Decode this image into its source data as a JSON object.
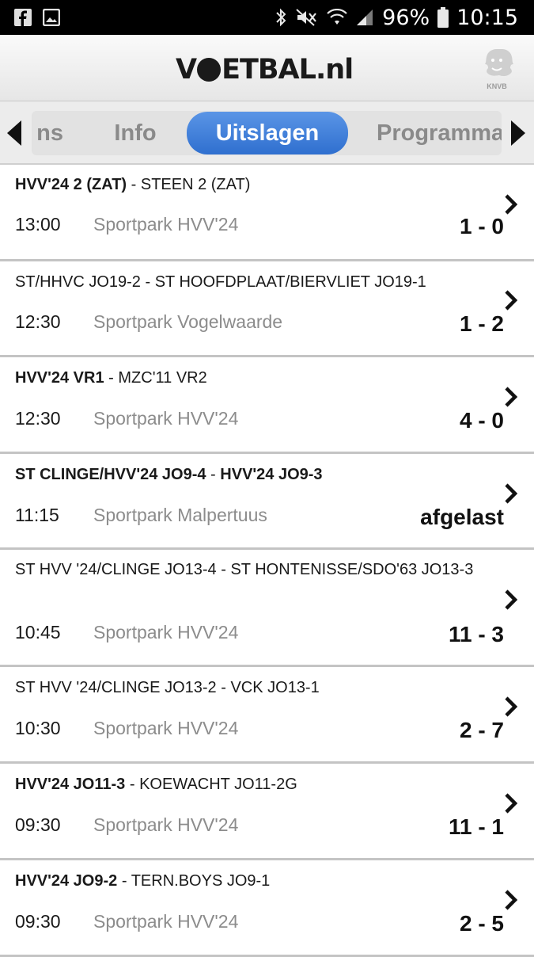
{
  "status_bar": {
    "battery_percent": "96%",
    "time": "10:15",
    "icons": [
      "facebook-icon",
      "gallery-icon",
      "bluetooth-icon",
      "mute-icon",
      "wifi-icon",
      "signal-icon",
      "battery-icon"
    ]
  },
  "header": {
    "logo_text_left": "V",
    "logo_text_right": "ETBAL.nl",
    "knvb_label": "KNVB"
  },
  "tabs": {
    "partial_label": "ns",
    "items": [
      "Info",
      "Uitslagen",
      "Programma"
    ],
    "active": "Uitslagen"
  },
  "matches": [
    {
      "home": "HVV'24 2 (ZAT)",
      "home_bold": true,
      "sep": " - ",
      "away": "STEEN 2 (ZAT)",
      "away_bold": false,
      "time": "13:00",
      "venue": "Sportpark HVV'24",
      "score": "1 - 0"
    },
    {
      "home": "ST/HHVC JO19-2",
      "home_bold": false,
      "sep": " - ",
      "away": "ST HOOFDPLAAT/BIERVLIET JO19-1",
      "away_bold": false,
      "time": "12:30",
      "venue": "Sportpark Vogelwaarde",
      "score": "1 - 2"
    },
    {
      "home": "HVV'24 VR1",
      "home_bold": true,
      "sep": " - ",
      "away": "MZC'11 VR2",
      "away_bold": false,
      "time": "12:30",
      "venue": "Sportpark HVV'24",
      "score": "4 - 0"
    },
    {
      "home": "ST CLINGE/HVV'24 JO9-4",
      "home_bold": true,
      "sep": " - ",
      "away": "HVV'24 JO9-3",
      "away_bold": true,
      "time": "11:15",
      "venue": "Sportpark Malpertuus",
      "score": "afgelast"
    },
    {
      "home": "ST HVV '24/CLINGE JO13-4",
      "home_bold": false,
      "sep": " - ",
      "away": "ST HONTENISSE/SDO'63 JO13-3",
      "away_bold": false,
      "time": "10:45",
      "venue": "Sportpark HVV'24",
      "score": "11 - 3"
    },
    {
      "home": "ST HVV '24/CLINGE JO13-2",
      "home_bold": false,
      "sep": " - ",
      "away": "VCK JO13-1",
      "away_bold": false,
      "time": "10:30",
      "venue": "Sportpark HVV'24",
      "score": "2 - 7"
    },
    {
      "home": "HVV'24 JO11-3",
      "home_bold": true,
      "sep": " - ",
      "away": "KOEWACHT JO11-2G",
      "away_bold": false,
      "time": "09:30",
      "venue": "Sportpark HVV'24",
      "score": "11 - 1"
    },
    {
      "home": "HVV'24 JO9-2",
      "home_bold": true,
      "sep": " - ",
      "away": "TERN.BOYS JO9-1",
      "away_bold": false,
      "time": "09:30",
      "venue": "Sportpark HVV'24",
      "score": "2 - 5"
    }
  ]
}
